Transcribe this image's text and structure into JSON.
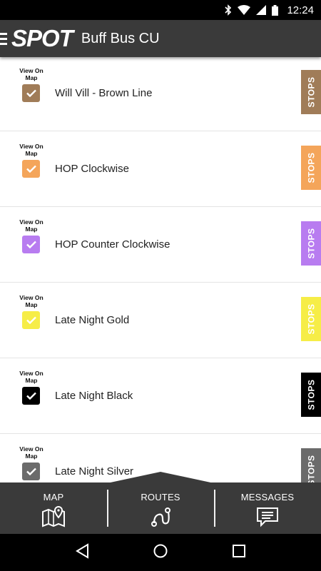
{
  "status_bar": {
    "time": "12:24"
  },
  "app_bar": {
    "logo_text": "SPOT",
    "title": "Buff Bus CU"
  },
  "routes": [
    {
      "view_label": "View On Map",
      "name": "Will Vill - Brown Line",
      "color": "#a07c58",
      "checked": true,
      "stops_label": "STOPS"
    },
    {
      "view_label": "View On Map",
      "name": "HOP Clockwise",
      "color": "#f4a55a",
      "checked": true,
      "stops_label": "STOPS"
    },
    {
      "view_label": "View On Map",
      "name": "HOP Counter Clockwise",
      "color": "#b87cf0",
      "checked": true,
      "stops_label": "STOPS"
    },
    {
      "view_label": "View On Map",
      "name": "Late Night Gold",
      "color": "#f6ed47",
      "checked": true,
      "stops_label": "STOPS"
    },
    {
      "view_label": "View On Map",
      "name": "Late Night Black",
      "color": "#000000",
      "checked": true,
      "stops_label": "STOPS"
    },
    {
      "view_label": "View On Map",
      "name": "Late Night Silver",
      "color": "#6b6b6b",
      "checked": true,
      "stops_label": "STOPS"
    }
  ],
  "bottom_nav": {
    "map": "MAP",
    "routes": "ROUTES",
    "messages": "MESSAGES"
  }
}
